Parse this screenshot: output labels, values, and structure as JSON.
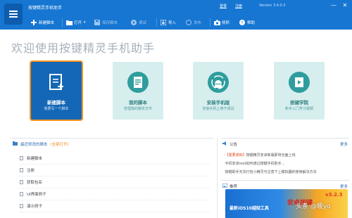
{
  "titlebar": {
    "app_title": "按键精灵手机助手",
    "login_label": "登录",
    "signup_label": "注册",
    "version": "Version  3.4.0.3",
    "minimize": "—",
    "close": "✕"
  },
  "toolbar": {
    "new_script": "新建脚本",
    "open": "打开",
    "save": "保存脚本",
    "debug": "调试",
    "import": "导入",
    "publish": "发布",
    "capture": "抓抓",
    "help": "帮助"
  },
  "welcome": "欢迎使用按键精灵手机助手",
  "cards": [
    {
      "title": "新建脚本",
      "subtitle": "我要写一个脚本",
      "icon": "new-document-icon"
    },
    {
      "title": "我的脚本",
      "subtitle": "管理我的脚本文件",
      "icon": "document-icon"
    },
    {
      "title": "安装手机版",
      "subtitle": "安装手机上用于调试",
      "icon": "android-install-icon"
    },
    {
      "title": "按键学院",
      "subtitle": "新手入门学习视频",
      "icon": "video-icon"
    }
  ],
  "recent": {
    "header": "最近修改的脚本",
    "clear": "(全部打开)",
    "items": [
      "新建脚本",
      "注册",
      "获取包名",
      "UI界面例子",
      "演示例子"
    ]
  },
  "news": {
    "title": "公告",
    "more": "更多",
    "items": [
      {
        "tag": "【重要通知】",
        "text": "按键精灵安卓新版即将全面上线"
      },
      {
        "tag": "",
        "text": "手机安卓root如何通过按键手机助手…"
      },
      {
        "tag": "",
        "text": "按键助手无法打包小精灵与注意下上模拟器的使用解决方法"
      }
    ]
  },
  "showcase": {
    "title": "推荐",
    "more": "更多",
    "ad_left": "最新iOS10越狱工具",
    "ad_right": "安卓按键",
    "ad_version": "v3.2.3"
  },
  "watermark": "头条 @暖yo",
  "colors": {
    "topbar": "#1676d2",
    "accent_orange": "#f7931e",
    "card_primary": "#1467b6",
    "card_alt": "#d7eeee"
  }
}
